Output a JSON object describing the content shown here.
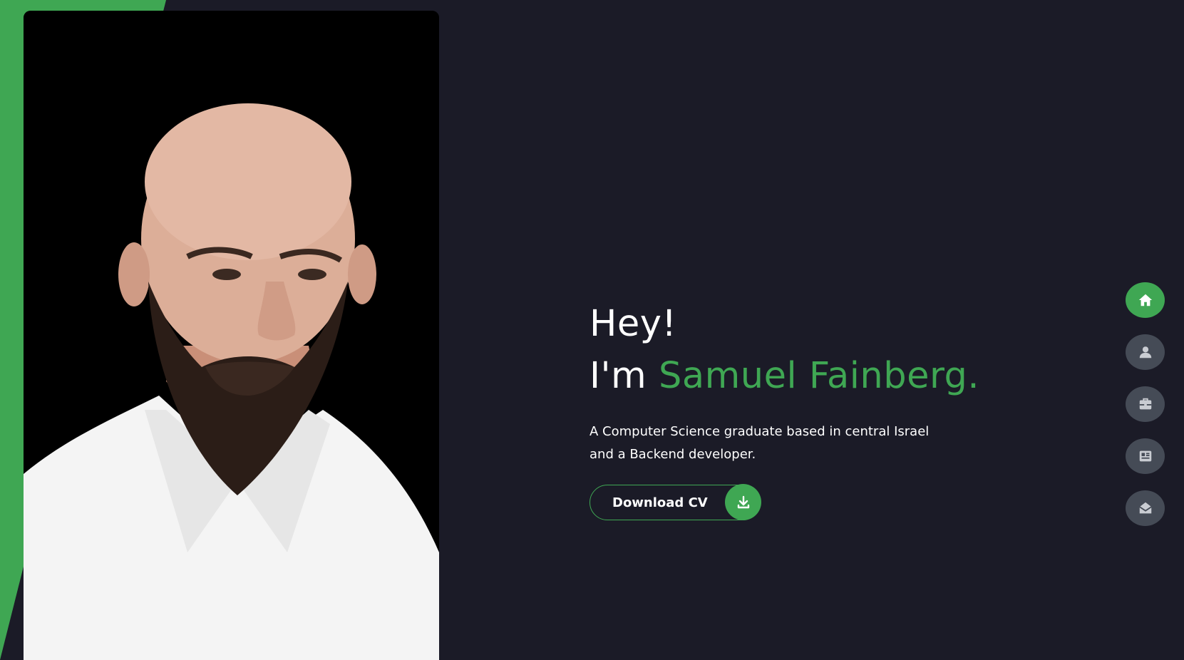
{
  "hero": {
    "greeting": "Hey!",
    "intro_prefix": "I'm ",
    "name": "Samuel Fainberg.",
    "description": "A Computer Science graduate based in central Israel and a Backend developer.",
    "cv_button_label": "Download CV"
  },
  "colors": {
    "accent": "#3fa753",
    "background": "#1b1b27",
    "nav_inactive": "#454b56"
  },
  "side_nav": [
    {
      "icon": "home-icon",
      "active": true
    },
    {
      "icon": "user-icon",
      "active": false
    },
    {
      "icon": "briefcase-icon",
      "active": false
    },
    {
      "icon": "newspaper-icon",
      "active": false
    },
    {
      "icon": "envelope-open-icon",
      "active": false
    }
  ]
}
